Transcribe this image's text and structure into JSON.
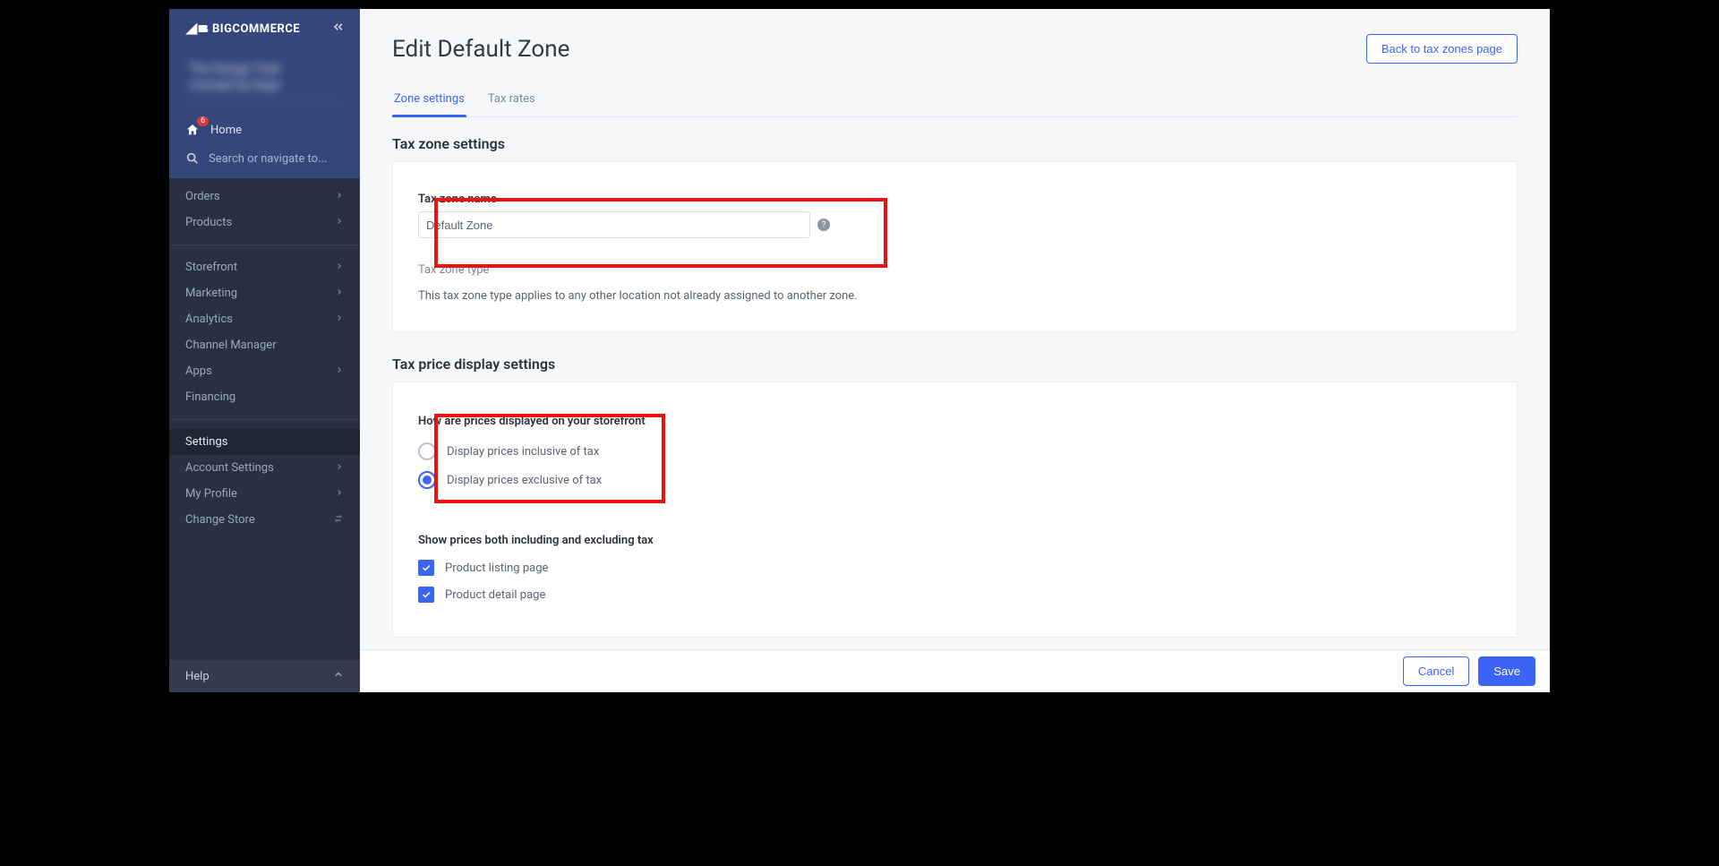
{
  "brand": {
    "name": "BIGCOMMERCE"
  },
  "sidebar": {
    "store_name_lines": [
      "The Design Task",
      "concept by dsgn"
    ],
    "home": {
      "label": "Home",
      "badge": "6"
    },
    "search": {
      "placeholder": "Search or navigate to..."
    },
    "nav1": [
      {
        "label": "Orders",
        "expandable": true
      },
      {
        "label": "Products",
        "expandable": true
      }
    ],
    "nav2": [
      {
        "label": "Storefront",
        "expandable": true
      },
      {
        "label": "Marketing",
        "expandable": true
      },
      {
        "label": "Analytics",
        "expandable": true
      },
      {
        "label": "Channel Manager",
        "expandable": false
      },
      {
        "label": "Apps",
        "expandable": true
      },
      {
        "label": "Financing",
        "expandable": false
      }
    ],
    "nav3": [
      {
        "label": "Settings",
        "expandable": false,
        "active": true
      },
      {
        "label": "Account Settings",
        "expandable": true
      },
      {
        "label": "My Profile",
        "expandable": true
      },
      {
        "label": "Change Store",
        "expandable": false,
        "swap": true
      }
    ],
    "footer": {
      "label": "Help"
    }
  },
  "page": {
    "title": "Edit Default Zone",
    "back_button": "Back to tax zones page",
    "tabs": [
      {
        "label": "Zone settings",
        "active": true
      },
      {
        "label": "Tax rates",
        "active": false
      }
    ]
  },
  "zone_settings": {
    "section_title": "Tax zone settings",
    "name_label": "Tax zone name",
    "name_value": "Default Zone",
    "type_label": "Tax zone type",
    "type_desc": "This tax zone type applies to any other location not already assigned to another zone."
  },
  "price_display": {
    "section_title": "Tax price display settings",
    "question": "How are prices displayed on your storefront",
    "options": [
      {
        "label": "Display prices inclusive of tax",
        "checked": false
      },
      {
        "label": "Display prices exclusive of tax",
        "checked": true
      }
    ],
    "show_both_label": "Show prices both including and excluding tax",
    "checkboxes": [
      {
        "label": "Product listing page",
        "checked": true
      },
      {
        "label": "Product detail page",
        "checked": true
      }
    ]
  },
  "footer": {
    "cancel": "Cancel",
    "save": "Save"
  }
}
